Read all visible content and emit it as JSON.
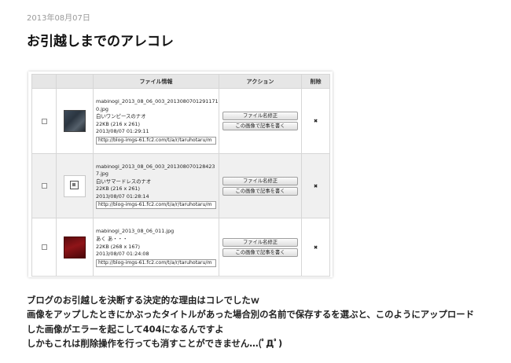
{
  "post": {
    "date": "2013年08月07日",
    "title": "お引越しまでのアレコレ"
  },
  "table": {
    "headers": [
      "",
      "",
      "ファイル情報",
      "アクション",
      "削除"
    ],
    "rows": [
      {
        "filename": "mabinogi_2013_08_06_003_20130807012911710.jpg",
        "title": "白いワンピースのナオ",
        "size": "22KB (216 x 261)",
        "date": "2013/08/07 01:29:11",
        "url": "http://blog-imgs-61.fc2.com/t/a/r/taruhotaru/m",
        "thumb_icon": "dark-blue-thumbnail-icon"
      },
      {
        "filename": "mabinogi_2013_08_06_003_201308070128423 7.jpg",
        "title": "白いサマードレスのナオ",
        "size": "22KB (216 x 261)",
        "date": "2013/08/07 01:28:14",
        "url": "http://blog-imgs-61.fc2.com/t/a/r/taruhotaru/m",
        "thumb_icon": "broken-image-icon"
      },
      {
        "filename": "mabinogi_2013_08_06_011.jpg",
        "title": "あく あ・・・",
        "size": "22KB (268 x 167)",
        "date": "2013/08/07 01:24:08",
        "url": "http://blog-imgs-61.fc2.com/t/a/r/taruhotaru/m",
        "thumb_icon": "dark-red-thumbnail-icon"
      }
    ],
    "rename_label": "ファイル名修正",
    "write_label": "この画像で記事を書く",
    "delete_icon": "✖"
  },
  "body": {
    "lines": [
      "ブログのお引越しを決断する決定的な理由はコレでしたｗ",
      "画像をアップしたときにかぶったタイトルがあった場合別の名前で保存するを選ぶと、このようにアップロード",
      "した画像がエラーを起こして404になるんですよ",
      "しかもこれは削除操作を行っても消すことができません…(ﾟДﾟ)"
    ]
  },
  "colors": {
    "delete": "#c8282b",
    "header_bg": "#e6e6e6",
    "alt_row_bg": "#f0f0f0"
  }
}
